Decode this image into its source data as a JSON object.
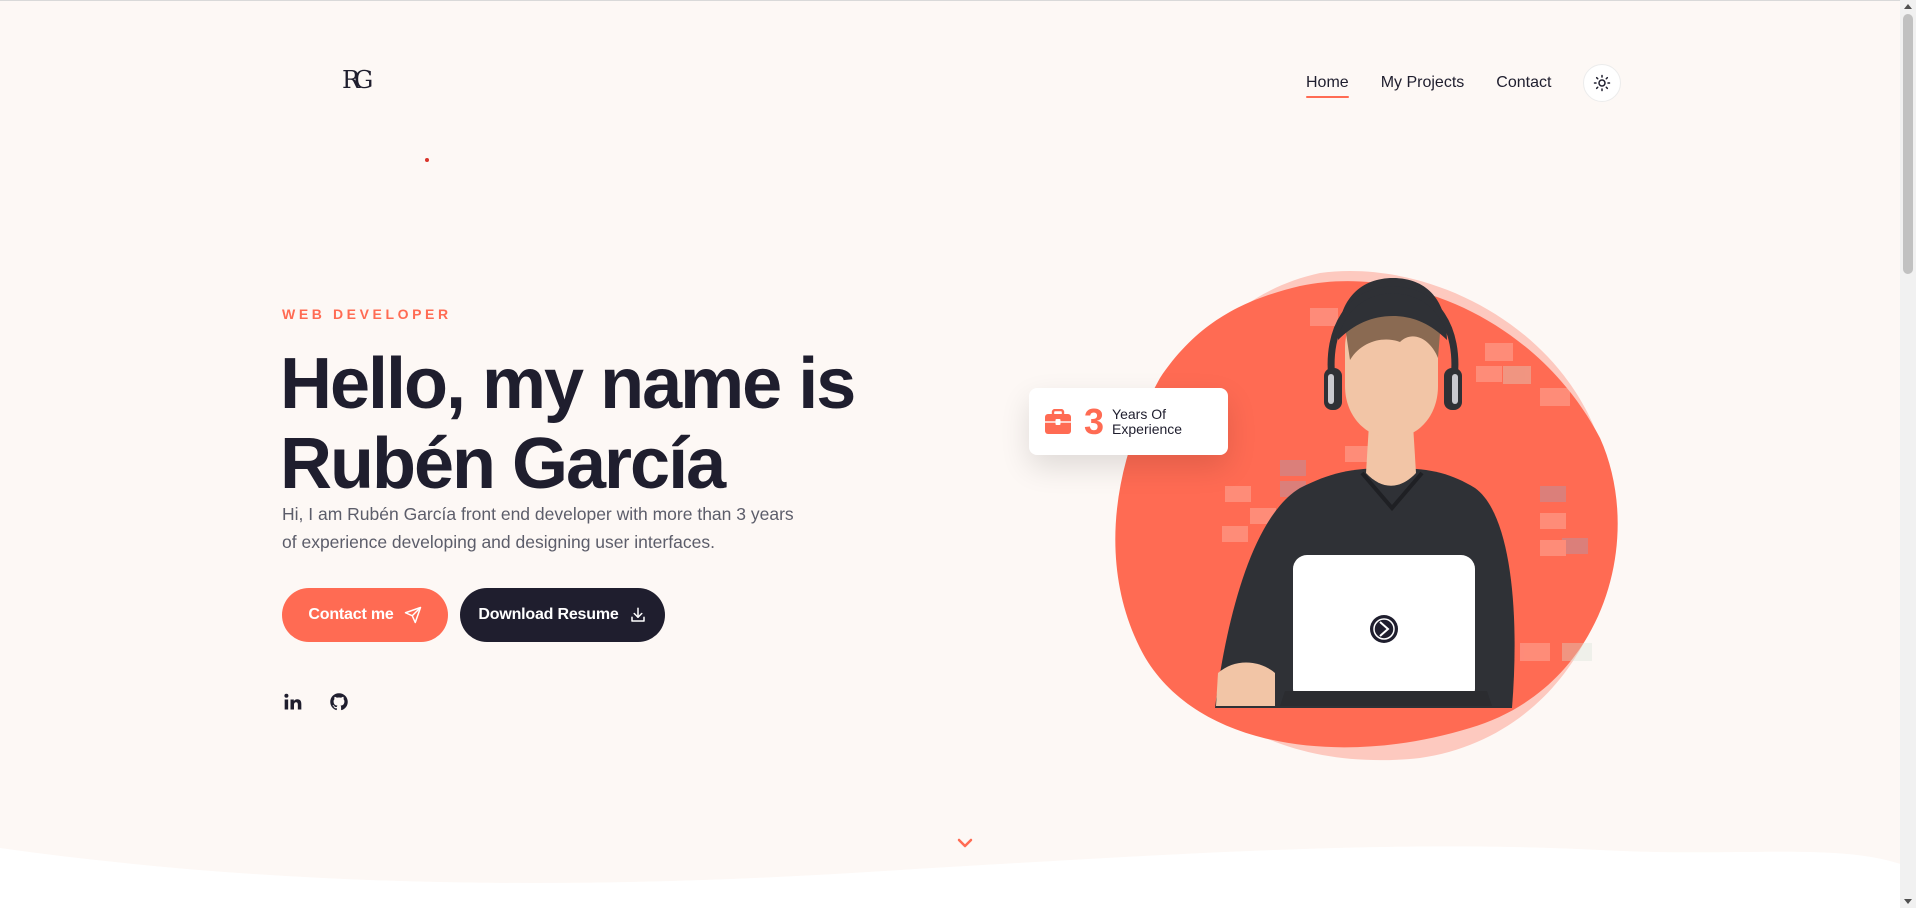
{
  "header": {
    "logo_text": "RG",
    "nav": [
      {
        "label": "Home",
        "active": true
      },
      {
        "label": "My Projects",
        "active": false
      },
      {
        "label": "Contact",
        "active": false
      }
    ],
    "theme_toggle_icon": "sun-icon"
  },
  "hero": {
    "eyebrow": "WEB DEVELOPER",
    "headline_line1": "Hello, my name is",
    "headline_line2": "Rubén García",
    "intro": "Hi, I am Rubén García front end developer with more than 3 years of experience developing and designing user interfaces.",
    "buttons": {
      "contact": {
        "label": "Contact me",
        "icon": "send-icon"
      },
      "resume": {
        "label": "Download Resume",
        "icon": "download-icon"
      }
    },
    "social": [
      {
        "name": "linkedin",
        "icon": "linkedin-icon"
      },
      {
        "name": "github",
        "icon": "github-icon"
      }
    ]
  },
  "experience_card": {
    "icon": "briefcase-icon",
    "number": "3",
    "label": "Years Of Experience"
  },
  "scroll_hint_icon": "chevron-down-icon",
  "colors": {
    "accent": "#ff6b53",
    "dark": "#1f1e2e",
    "background": "#fdf8f5",
    "blob_light": "#fdc9bf"
  }
}
